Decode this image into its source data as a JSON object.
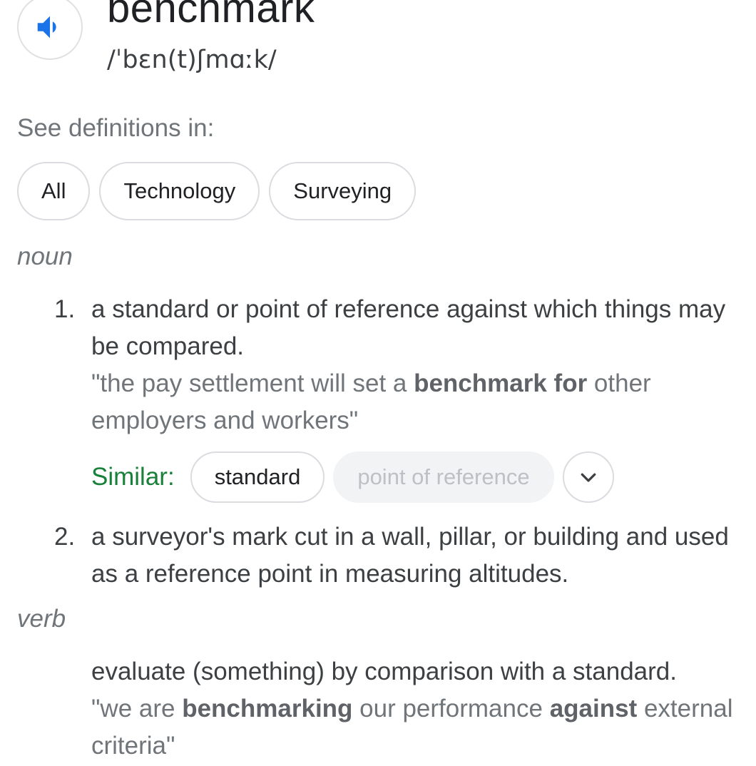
{
  "entry": {
    "word": "benchmark",
    "phonetic": "/ˈbɛn(t)ʃmɑːk/",
    "speaker_icon": "volume-up-icon"
  },
  "see_definitions": {
    "label": "See definitions in:",
    "chips": [
      "All",
      "Technology",
      "Surveying"
    ]
  },
  "noun": {
    "label": "noun",
    "senses": [
      {
        "number": "1.",
        "definition": "a standard or point of reference against which things may be compared.",
        "example": {
          "open_quote": "\"the pay settlement will set a ",
          "bold": "benchmark for",
          "rest": " other employers and workers\""
        },
        "similar": {
          "label": "Similar:",
          "words": [
            "standard",
            "point of reference"
          ],
          "expand_icon": "chevron-down-icon"
        }
      },
      {
        "number": "2.",
        "definition": "a surveyor's mark cut in a wall, pillar, or building and used as a reference point in measuring altitudes."
      }
    ]
  },
  "verb": {
    "label": "verb",
    "definition": "evaluate (something) by comparison with a standard.",
    "example": {
      "part1": "\"we are ",
      "bold1": "benchmarking",
      "part2": " our performance ",
      "bold2": "against",
      "part3": " external criteria\""
    }
  },
  "colors": {
    "speaker_blue": "#1a73e8",
    "similar_green": "#188038",
    "muted_text": "#70757a"
  }
}
